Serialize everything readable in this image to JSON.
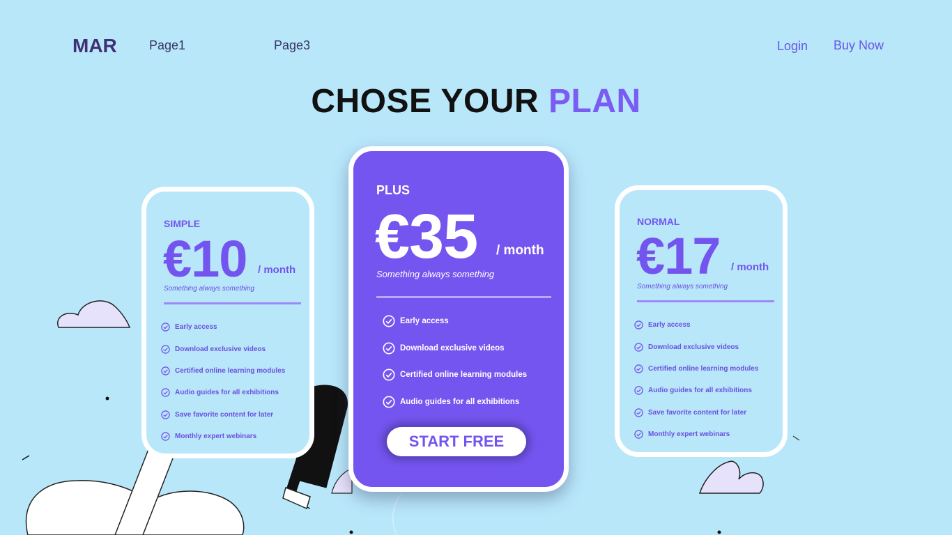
{
  "colors": {
    "background": "#b8e7fa",
    "accent": "#7454ee",
    "logo": "#3f2f73",
    "plus_card": "#7555ef"
  },
  "nav": {
    "logo": "MAR",
    "links": [
      "Page1",
      "Page3"
    ],
    "login": "Login",
    "buy_now": "Buy Now"
  },
  "hero": {
    "title_main": "CHOSE YOUR ",
    "title_accent": "PLAN"
  },
  "plans": {
    "simple": {
      "name": "SIMPLE",
      "price": "€10",
      "per": "/ month",
      "tagline": "Something always something",
      "features": [
        "Early access",
        "Download exclusive videos",
        "Certified online learning modules",
        "Audio guides for all exhibitions",
        "Save favorite content for later",
        "Monthly expert webinars"
      ]
    },
    "plus": {
      "name": "PLUS",
      "price": "€35",
      "per": "/ month",
      "tagline": "Something always something",
      "features": [
        "Early access",
        "Download exclusive videos",
        "Certified online learning modules",
        "Audio guides for all exhibitions"
      ],
      "cta": "START FREE"
    },
    "normal": {
      "name": "NORMAL",
      "price": "€17",
      "per": "/ month",
      "tagline": "Something always something",
      "features": [
        "Early access",
        "Download exclusive videos",
        "Certified online learning modules",
        "Audio guides for all exhibitions",
        "Save favorite content for later",
        "Monthly expert webinars"
      ]
    }
  },
  "icons": {
    "feature_check": "check-circle-icon"
  }
}
